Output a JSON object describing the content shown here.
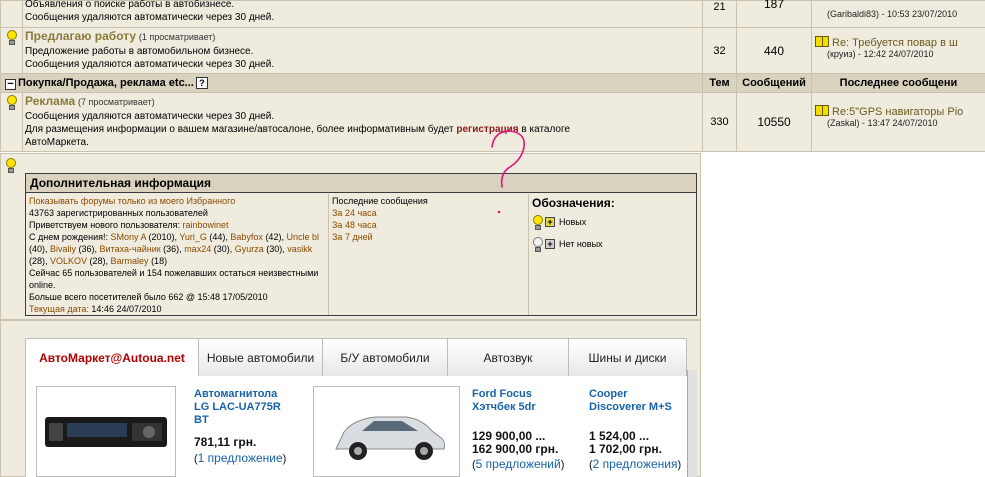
{
  "forums": [
    {
      "desc": "Объявления о поиске работы в автобизнесе.",
      "desc2": "Сообщения удаляются автоматически через 30 дней.",
      "topics": "21",
      "messages": "187",
      "last_meta": "(Garibaldi83) - 10:53 23/07/2010"
    },
    {
      "title": "Предлагаю работу",
      "viewing": "(1 просматривает)",
      "desc": "Предложение работы в автомобильном бизнесе.",
      "desc2": "Сообщения удаляются автоматически через 30 дней.",
      "topics": "32",
      "messages": "440",
      "last_link": "Re: Требуется повар в ш",
      "last_meta": "(круиз) - 12:42 24/07/2010"
    }
  ],
  "category": {
    "title": "Покупка/Продажа, реклама etc...",
    "help": "?",
    "col_topics": "Тем",
    "col_messages": "Сообщений",
    "col_last": "Последнее сообщени"
  },
  "ad_forum": {
    "title": "Реклама",
    "viewing": "(7 просматривает)",
    "desc": "Сообщения удаляются автоматически через 30 дней.",
    "desc_pre": "Для размещения информации о вашем магазине/автосалоне, более информативным будет ",
    "desc_link": "регистрация",
    "desc_post": " в каталоге АвтоМаркета.",
    "topics": "330",
    "messages": "10550",
    "last_link": "Re:5\"GPS навигаторы Pio",
    "last_meta": "(Zaskal) - 13:47 24/07/2010"
  },
  "info": {
    "header": "Дополнительная информация",
    "show_fav": "Показывать форумы только из моего Избранного",
    "registered": "43763 зарегистрированных пользователей",
    "welcome_pre": "Приветствуем нового пользователя: ",
    "welcome_user": "rainbowinet",
    "birthday_pre": "С днем рождения!: ",
    "birthdays": [
      {
        "name": "SMony A",
        "age": " (2010), "
      },
      {
        "name": "Yuri_G",
        "age": " (44), "
      },
      {
        "name": "Babyfox",
        "age": " (42), "
      },
      {
        "name": "Uncle bl",
        "age": " (40), "
      },
      {
        "name": "Bivaliy",
        "age": " (36), "
      },
      {
        "name": "Витаха-чайник",
        "age": " (36), "
      },
      {
        "name": "max24",
        "age": " (30), "
      },
      {
        "name": "Gyurza",
        "age": " (30), "
      },
      {
        "name": "vasikk",
        "age": " (28), "
      },
      {
        "name": "VOLKOV",
        "age": " (28), "
      },
      {
        "name": "Barmaley",
        "age": " (18)"
      }
    ],
    "online": "Сейчас 65 пользователей и 154 пожелавших остаться неизвестными online.",
    "max_online": "Больше всего посетителей было 662 @ 15:48 17/05/2010",
    "current_date_label": "Текущая дата: ",
    "current_date": "14:46 24/07/2010",
    "recent_title": "Последние сообщения",
    "recent_links": [
      "За 24 часа",
      "За 48 часа",
      "За 7 дней"
    ],
    "legend_title": "Обозначения:",
    "legend_new": "Новых",
    "legend_none": "Нет новых",
    "plus": "+"
  },
  "market": {
    "tabs": [
      {
        "label": "АвтоМаркет@Autoua.net"
      },
      {
        "label": "Новые автомобили"
      },
      {
        "label": "Б/У автомобили"
      },
      {
        "label": "Автозвук"
      },
      {
        "label": "Шины и диски"
      }
    ],
    "products": [
      {
        "title1": "Автомагнитола",
        "title2": "LG LAC-UA775R",
        "title3": "BT",
        "price1": "781,11 грн.",
        "price2": "",
        "offers": "1 предложение"
      },
      {
        "title1": "Ford Focus",
        "title2": "Хэтчбек 5dr",
        "title3": "",
        "price1": "129 900,00 ...",
        "price2": "162 900,00 грн.",
        "offers": "5 предложений"
      },
      {
        "title1": "Cooper",
        "title2": "Discoverer M+S",
        "title3": "",
        "price1": "1 524,00 ...",
        "price2": "1 702,00 грн.",
        "offers": "2 предложения"
      }
    ],
    "paren_open": "(",
    "paren_close": ")"
  },
  "colors": {
    "forum_bg": "#efebde",
    "category_bg": "#d8d2bf",
    "forum_title": "#8a7b3e",
    "link_blue": "#1762a8",
    "active_tab": "#b00000",
    "annotation": "#e0147a"
  }
}
